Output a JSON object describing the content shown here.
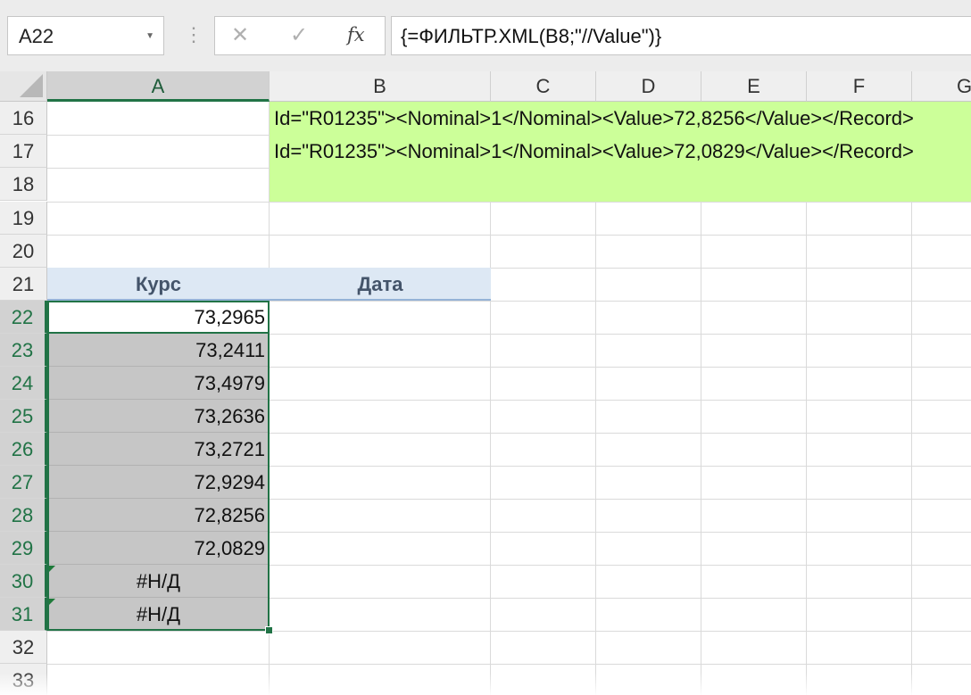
{
  "formula_bar": {
    "name_box": "A22",
    "cancel_glyph": "✕",
    "enter_glyph": "✓",
    "fx_glyph": "fx",
    "formula": "{=ФИЛЬТР.XML(B8;\"//Value\")}"
  },
  "columns": [
    "A",
    "B",
    "C",
    "D",
    "E",
    "F",
    "G"
  ],
  "rows": [
    "16",
    "17",
    "18",
    "19",
    "20",
    "21",
    "22",
    "23",
    "24",
    "25",
    "26",
    "27",
    "28",
    "29",
    "30",
    "31",
    "32",
    "33"
  ],
  "xml_rows": [
    "Id=\"R01235\"><Nominal>1</Nominal><Value>72,8256</Value></Record>",
    "Id=\"R01235\"><Nominal>1</Nominal><Value>72,0829</Value></Record>"
  ],
  "table": {
    "headers": [
      "Курс",
      "Дата"
    ],
    "values": [
      "73,2965",
      "73,2411",
      "73,4979",
      "73,2636",
      "73,2721",
      "72,9294",
      "72,8256",
      "72,0829",
      "#Н/Д",
      "#Н/Д"
    ]
  },
  "colors": {
    "accent": "#217346",
    "xml_fill": "#ccff99",
    "table_header_fill": "#dde8f4",
    "selection_fill": "#c6c6c6"
  }
}
